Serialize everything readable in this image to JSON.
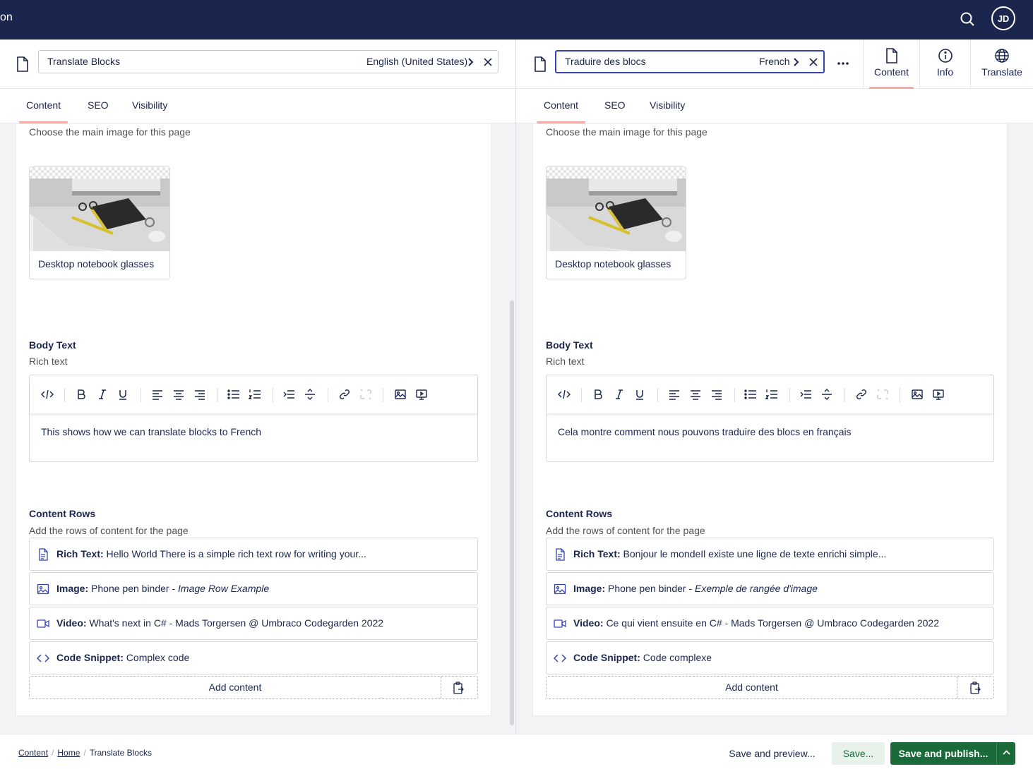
{
  "header": {
    "brand_partial": "on",
    "user_initials": "JD",
    "search_icon": "search-icon"
  },
  "colors": {
    "header_bg": "#1b264f",
    "accent_tab": "#f5a7a1",
    "publish_green": "#1b6b3a"
  },
  "left": {
    "doc_name": "Translate Blocks",
    "culture": "English (United States)",
    "tabs": [
      "Content",
      "SEO",
      "Visibility"
    ],
    "active_tab": "Content",
    "image_desc": "Choose the main image for this page",
    "media_caption": "Desktop notebook glasses",
    "body_label": "Body Text",
    "body_desc": "Rich text",
    "body_text": "This shows how we can translate blocks to French",
    "rows_label": "Content Rows",
    "rows_desc": "Add the rows of content for the page",
    "blocks": [
      {
        "type": "Rich Text",
        "text": "Hello World There is a simple rich text row for writing your...",
        "italic": "",
        "icon": "document-icon"
      },
      {
        "type": "Image",
        "text": "Phone pen binder - ",
        "italic": "Image Row Example",
        "icon": "image-icon"
      },
      {
        "type": "Video",
        "text": "What's next in C# - Mads Torgersen @ Umbraco Codegarden 2022",
        "italic": "",
        "icon": "video-icon"
      },
      {
        "type": "Code Snippet",
        "text": "Complex code",
        "italic": "",
        "icon": "code-icon"
      }
    ],
    "add_content": "Add content"
  },
  "right": {
    "doc_name": "Traduire des blocs",
    "culture": "French",
    "tabs": [
      "Content",
      "SEO",
      "Visibility"
    ],
    "active_tab": "Content",
    "image_desc": "Choose the main image for this page",
    "media_caption": "Desktop notebook glasses",
    "body_label": "Body Text",
    "body_desc": "Rich text",
    "body_text": "Cela montre comment nous pouvons traduire des blocs en français",
    "rows_label": "Content Rows",
    "rows_desc": "Add the rows of content for the page",
    "blocks": [
      {
        "type": "Rich Text",
        "text": "Bonjour le mondeIl existe une ligne de texte enrichi simple...",
        "italic": "",
        "icon": "document-icon"
      },
      {
        "type": "Image",
        "text": "Phone pen binder - ",
        "italic": "Exemple de rangée d'image",
        "icon": "image-icon"
      },
      {
        "type": "Video",
        "text": "Ce qui vient ensuite en C# - Mads Torgersen @ Umbraco Codegarden 2022",
        "italic": "",
        "icon": "video-icon"
      },
      {
        "type": "Code Snippet",
        "text": "Code complexe",
        "italic": "",
        "icon": "code-icon"
      }
    ],
    "add_content": "Add content"
  },
  "apps": [
    {
      "label": "Content",
      "icon": "document-icon",
      "active": true
    },
    {
      "label": "Info",
      "icon": "info-icon",
      "active": false
    },
    {
      "label": "Translate",
      "icon": "globe-icon",
      "active": false
    }
  ],
  "footer": {
    "breadcrumb": [
      "Content",
      "Home",
      "Translate Blocks"
    ],
    "save_preview": "Save and preview...",
    "save": "Save...",
    "save_publish": "Save and publish..."
  }
}
